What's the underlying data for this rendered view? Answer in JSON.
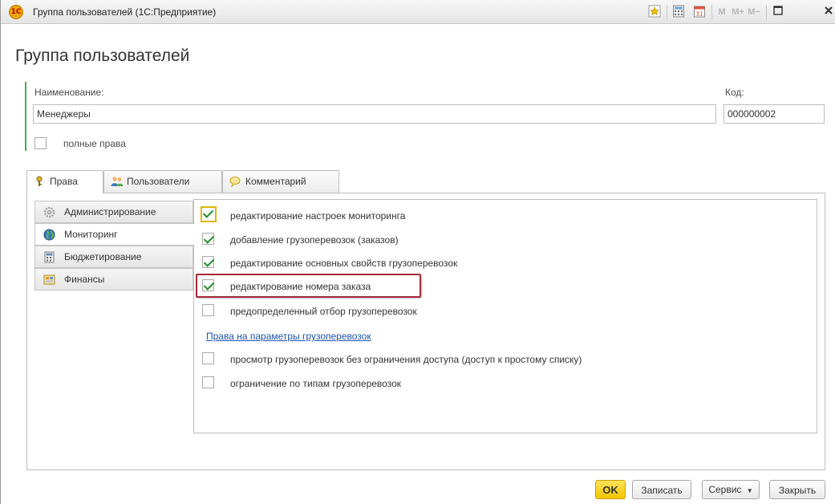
{
  "window": {
    "title": "Группа пользователей  (1С:Предприятие)",
    "app_icon": "1С",
    "memory_buttons": [
      "M",
      "M+",
      "M−"
    ]
  },
  "form": {
    "title": "Группа пользователей",
    "name_label": "Наименование:",
    "name_value": "Менеджеры",
    "code_label": "Код:",
    "code_value": "000000002",
    "full_rights_label": "полные права",
    "full_rights_checked": false
  },
  "tabs": [
    {
      "label": "Права",
      "icon": "key-icon",
      "active": true
    },
    {
      "label": "Пользователи",
      "icon": "users-icon",
      "active": false
    },
    {
      "label": "Комментарий",
      "icon": "comment-icon",
      "active": false
    }
  ],
  "sections": [
    {
      "label": "Администрирование",
      "icon": "gears-icon",
      "active": false
    },
    {
      "label": "Мониторинг",
      "icon": "globe-icon",
      "active": true
    },
    {
      "label": "Бюджетирование",
      "icon": "calculator-icon",
      "active": false
    },
    {
      "label": "Финансы",
      "icon": "finance-icon",
      "active": false
    }
  ],
  "rights": [
    {
      "label": "редактирование настроек мониторинга",
      "checked": true
    },
    {
      "label": "добавление грузоперевозок (заказов)",
      "checked": true
    },
    {
      "label": "редактирование основных свойств грузоперевозок",
      "checked": true
    },
    {
      "label": "редактирование номера заказа",
      "checked": true
    },
    {
      "label": "предопределенный отбор грузоперевозок",
      "checked": false
    }
  ],
  "params_link": "Права на параметры грузоперевозок",
  "rights_more": [
    {
      "label": "просмотр грузоперевозок без ограничения доступа (доступ к простому списку)",
      "checked": false
    },
    {
      "label": "ограничение по типам грузоперевозок",
      "checked": false
    }
  ],
  "buttons": {
    "ok": "OK",
    "save": "Записать",
    "service": "Сервис",
    "close": "Закрыть"
  },
  "colors": {
    "accent_green": "#3cb44b",
    "highlight": "#a52a3a",
    "ok_yellow": "#f4c400",
    "link": "#1c52b0"
  }
}
